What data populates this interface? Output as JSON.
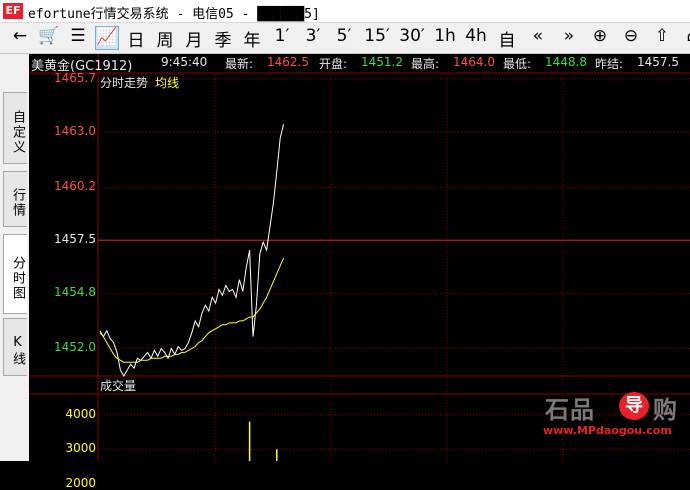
{
  "window": {
    "logo_text": "EF",
    "title": "efortune行情交易系统 - 电信05 - ██████5]"
  },
  "toolbar": {
    "items": [
      {
        "name": "back-icon",
        "label": "←"
      },
      {
        "name": "cart-icon",
        "label": "🛒"
      },
      {
        "name": "list-icon",
        "label": "☰"
      },
      {
        "name": "trend-icon",
        "label": "📈"
      },
      {
        "name": "day",
        "label": "日"
      },
      {
        "name": "week",
        "label": "周"
      },
      {
        "name": "month",
        "label": "月"
      },
      {
        "name": "season",
        "label": "季"
      },
      {
        "name": "year",
        "label": "年"
      },
      {
        "name": "1min",
        "label": "1′"
      },
      {
        "name": "3min",
        "label": "3′"
      },
      {
        "name": "5min",
        "label": "5′"
      },
      {
        "name": "15min",
        "label": "15′"
      },
      {
        "name": "30min",
        "label": "30′"
      },
      {
        "name": "1h",
        "label": "1h"
      },
      {
        "name": "4h",
        "label": "4h"
      },
      {
        "name": "custom",
        "label": "自"
      },
      {
        "name": "prev-icon",
        "label": "«"
      },
      {
        "name": "next-icon",
        "label": "»"
      },
      {
        "name": "zoom-in-icon",
        "label": "⊕"
      },
      {
        "name": "zoom-out-icon",
        "label": "⊖"
      },
      {
        "name": "up-icon",
        "label": "⇧"
      },
      {
        "name": "more-icon",
        "label": "⌂"
      }
    ]
  },
  "tabs": [
    {
      "label": "自定义",
      "active": false
    },
    {
      "label": "行情",
      "active": false
    },
    {
      "label": "分时图",
      "active": true
    },
    {
      "label": "K线",
      "active": false
    }
  ],
  "quote": {
    "symbol": "美黄金(GC1912)",
    "time": "9:45:40",
    "latest_label": "最新:",
    "latest": "1462.5",
    "open_label": "开盘:",
    "open": "1451.2",
    "high_label": "最高:",
    "high": "1464.0",
    "low_label": "最低:",
    "low": "1448.8",
    "prev_close_label": "昨结:",
    "prev_close": "1457.5"
  },
  "chart_labels": {
    "intraday": "分时走势",
    "avg": "均线",
    "volume": "成交量"
  },
  "colors": {
    "grid": "#8b0000",
    "price_line": "#ffffff",
    "avg_line": "#ffff33",
    "up": "#ff4d4d",
    "down": "#3fdc3f",
    "neutral": "#e6e6e6",
    "volume": "#ffff33"
  },
  "price_axis": {
    "ticks": [
      "1465.7",
      "1463.0",
      "1460.2",
      "1457.5",
      "1454.8",
      "1452.0"
    ],
    "tick_colors": [
      "up",
      "up",
      "up",
      "neutral",
      "down",
      "down"
    ]
  },
  "volume_axis": {
    "ticks": [
      "4000",
      "3000",
      "2000"
    ]
  },
  "watermark": {
    "brand": "石品",
    "logo": "导",
    "suffix": "购",
    "url": "www.MPdaogou.com"
  },
  "chart_data": [
    {
      "type": "line",
      "ylim": [
        1450.6,
        1466.0
      ],
      "series": [
        {
          "name": "分时走势",
          "values": [
            1452.8,
            1452.6,
            1452.9,
            1452.5,
            1452.3,
            1451.8,
            1450.9,
            1450.6,
            1450.9,
            1451.2,
            1451.0,
            1451.5,
            1451.4,
            1451.6,
            1451.8,
            1451.5,
            1451.9,
            1451.6,
            1452.0,
            1451.8,
            1451.5,
            1452.0,
            1451.7,
            1452.1,
            1451.9,
            1452.0,
            1452.3,
            1452.8,
            1453.4,
            1453.1,
            1453.8,
            1454.2,
            1453.9,
            1454.6,
            1454.3,
            1455.0,
            1454.7,
            1455.2,
            1454.9,
            1455.0,
            1454.6,
            1455.5,
            1454.9,
            1456.1,
            1457.0,
            1452.6,
            1454.2,
            1456.8,
            1457.4,
            1457.0,
            1458.2,
            1459.4,
            1461.0,
            1462.7,
            1463.4
          ]
        },
        {
          "name": "均线",
          "values": [
            1452.9,
            1452.6,
            1452.3,
            1452.0,
            1451.7,
            1451.5,
            1451.4,
            1451.3,
            1451.3,
            1451.3,
            1451.3,
            1451.3,
            1451.4,
            1451.4,
            1451.4,
            1451.5,
            1451.5,
            1451.5,
            1451.5,
            1451.6,
            1451.6,
            1451.6,
            1451.7,
            1451.7,
            1451.8,
            1451.8,
            1451.9,
            1452.0,
            1452.1,
            1452.3,
            1452.4,
            1452.6,
            1452.8,
            1452.9,
            1453.0,
            1453.1,
            1453.2,
            1453.2,
            1453.3,
            1453.3,
            1453.3,
            1453.4,
            1453.4,
            1453.5,
            1453.6,
            1453.6,
            1453.8,
            1454.0,
            1454.3,
            1454.6,
            1455.0,
            1455.4,
            1455.8,
            1456.2,
            1456.6
          ]
        }
      ]
    },
    {
      "type": "bar",
      "ylim": [
        1500,
        4600
      ],
      "series": [
        {
          "name": "成交量",
          "values": [
            0,
            0,
            0,
            0,
            0,
            0,
            0,
            0,
            0,
            0,
            0,
            0,
            0,
            0,
            0,
            0,
            0,
            0,
            0,
            0,
            0,
            0,
            0,
            0,
            0,
            0,
            0,
            0,
            0,
            0,
            0,
            0,
            0,
            0,
            0,
            0,
            0,
            0,
            0,
            0,
            0,
            0,
            0,
            0,
            3800,
            0,
            0,
            0,
            0,
            0,
            0,
            0,
            3000,
            0,
            0
          ]
        }
      ]
    }
  ]
}
